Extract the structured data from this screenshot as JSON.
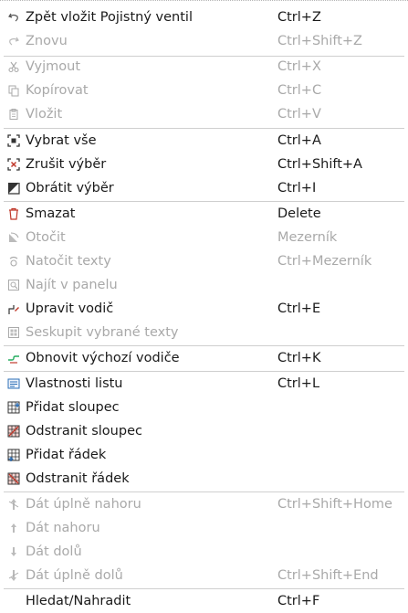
{
  "menu": {
    "items": [
      {
        "label": "Zpět vložit Pojistný ventil",
        "shortcut": "Ctrl+Z",
        "enabled": true,
        "icon": "undo-icon"
      },
      {
        "label": "Znovu",
        "shortcut": "Ctrl+Shift+Z",
        "enabled": false,
        "icon": "redo-icon"
      },
      {
        "label": "Vyjmout",
        "shortcut": "Ctrl+X",
        "enabled": false,
        "icon": "cut-icon"
      },
      {
        "label": "Kopírovat",
        "shortcut": "Ctrl+C",
        "enabled": false,
        "icon": "copy-icon"
      },
      {
        "label": "Vložit",
        "shortcut": "Ctrl+V",
        "enabled": false,
        "icon": "paste-icon"
      },
      {
        "label": "Vybrat vše",
        "shortcut": "Ctrl+A",
        "enabled": true,
        "icon": "select-all-icon"
      },
      {
        "label": "Zrušit výběr",
        "shortcut": "Ctrl+Shift+A",
        "enabled": true,
        "icon": "deselect-icon"
      },
      {
        "label": "Obrátit výběr",
        "shortcut": "Ctrl+I",
        "enabled": true,
        "icon": "invert-selection-icon"
      },
      {
        "label": "Smazat",
        "shortcut": "Delete",
        "enabled": true,
        "icon": "delete-icon"
      },
      {
        "label": "Otočit",
        "shortcut": "Mezerník",
        "enabled": false,
        "icon": "rotate-icon"
      },
      {
        "label": "Natočit texty",
        "shortcut": "Ctrl+Mezerník",
        "enabled": false,
        "icon": "rotate-text-icon"
      },
      {
        "label": "Najít v panelu",
        "shortcut": "",
        "enabled": false,
        "icon": "find-in-panel-icon"
      },
      {
        "label": "Upravit vodič",
        "shortcut": "Ctrl+E",
        "enabled": true,
        "icon": "edit-conductor-icon"
      },
      {
        "label": "Seskupit vybrané texty",
        "shortcut": "",
        "enabled": false,
        "icon": "group-texts-icon"
      },
      {
        "label": "Obnovit výchozí vodiče",
        "shortcut": "Ctrl+K",
        "enabled": true,
        "icon": "reset-conductors-icon"
      },
      {
        "label": "Vlastnosti listu",
        "shortcut": "Ctrl+L",
        "enabled": true,
        "icon": "sheet-properties-icon"
      },
      {
        "label": "Přidat sloupec",
        "shortcut": "",
        "enabled": true,
        "icon": "add-column-icon"
      },
      {
        "label": "Odstranit sloupec",
        "shortcut": "",
        "enabled": true,
        "icon": "remove-column-icon"
      },
      {
        "label": "Přidat řádek",
        "shortcut": "",
        "enabled": true,
        "icon": "add-row-icon"
      },
      {
        "label": "Odstranit řádek",
        "shortcut": "",
        "enabled": true,
        "icon": "remove-row-icon"
      },
      {
        "label": "Dát úplně nahoru",
        "shortcut": "Ctrl+Shift+Home",
        "enabled": false,
        "icon": "bring-to-front-icon"
      },
      {
        "label": "Dát nahoru",
        "shortcut": "",
        "enabled": false,
        "icon": "raise-icon"
      },
      {
        "label": "Dát dolů",
        "shortcut": "",
        "enabled": false,
        "icon": "lower-icon"
      },
      {
        "label": "Dát úplně dolů",
        "shortcut": "Ctrl+Shift+End",
        "enabled": false,
        "icon": "send-to-back-icon"
      },
      {
        "label": "Hledat/Nahradit",
        "shortcut": "Ctrl+F",
        "enabled": true,
        "icon": "find-replace-icon"
      }
    ]
  },
  "colors": {
    "text": "#1a1a1a",
    "disabled_text": "#a9a9a9",
    "separator": "#cfcfcf",
    "accent_red": "#c0392b",
    "accent_green": "#27ae60",
    "accent_blue": "#2c6fb7"
  }
}
